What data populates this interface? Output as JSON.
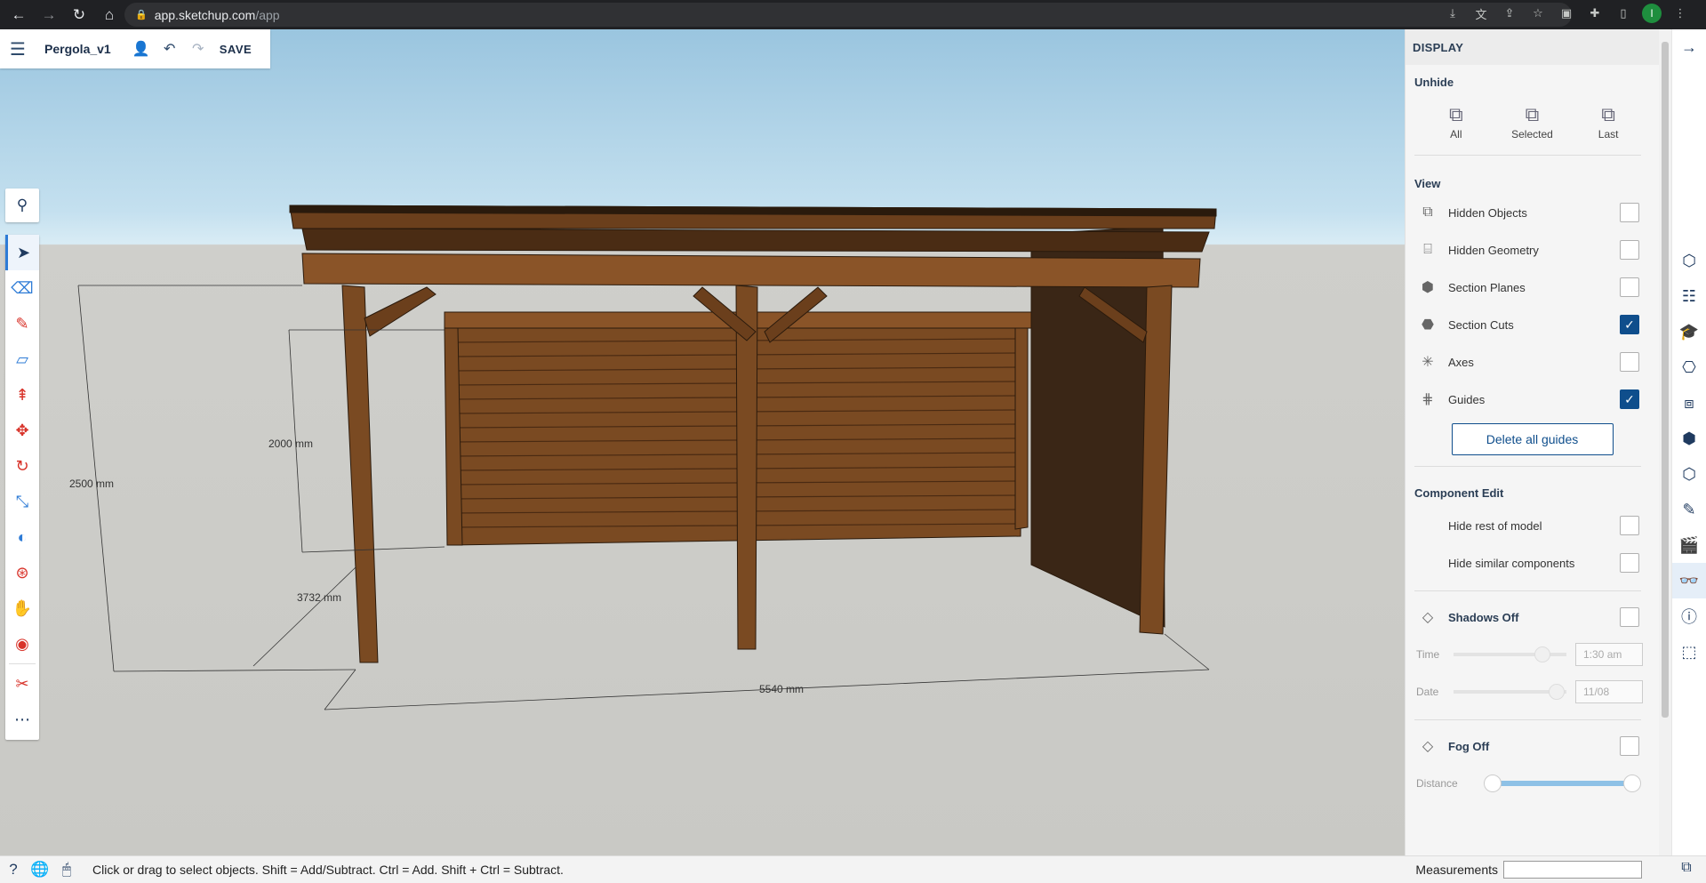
{
  "browser": {
    "url_host": "app.sketchup.com",
    "url_path": "/app"
  },
  "topbar": {
    "model_name": "Pergola_v1",
    "save_label": "SAVE"
  },
  "scene": {
    "dim_height_total": "2500 mm",
    "dim_height_inner": "2000 mm",
    "dim_depth": "3732 mm",
    "dim_width": "5540 mm"
  },
  "panel": {
    "title": "DISPLAY",
    "unhide": {
      "title": "Unhide",
      "all": "All",
      "selected": "Selected",
      "last": "Last"
    },
    "view": {
      "title": "View",
      "items": [
        {
          "label": "Hidden Objects",
          "checked": false
        },
        {
          "label": "Hidden Geometry",
          "checked": false
        },
        {
          "label": "Section Planes",
          "checked": false
        },
        {
          "label": "Section Cuts",
          "checked": true
        },
        {
          "label": "Axes",
          "checked": false
        },
        {
          "label": "Guides",
          "checked": true
        }
      ],
      "delete_guides": "Delete all guides"
    },
    "component_edit": {
      "title": "Component Edit",
      "hide_rest": "Hide rest of model",
      "hide_similar": "Hide similar components"
    },
    "shadows": {
      "title": "Shadows Off",
      "time_label": "Time",
      "time_value": "1:30 am",
      "date_label": "Date",
      "date_value": "11/08"
    },
    "fog": {
      "title": "Fog Off",
      "distance_label": "Distance"
    }
  },
  "status": {
    "hint": "Click or drag to select objects. Shift = Add/Subtract. Ctrl = Add. Shift + Ctrl = Subtract.",
    "measurements_label": "Measurements"
  }
}
